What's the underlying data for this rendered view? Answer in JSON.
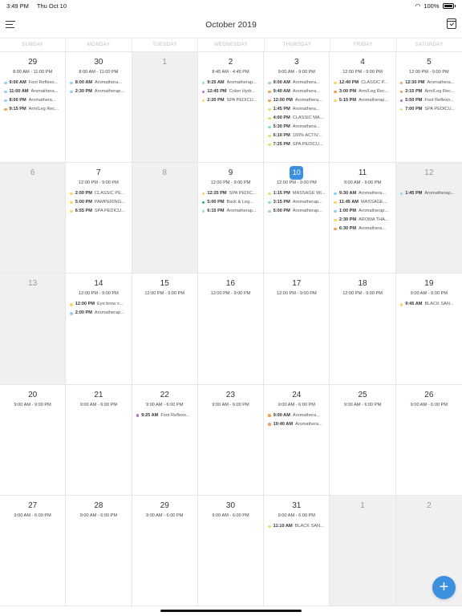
{
  "status_bar": {
    "time": "3:49 PM",
    "date": "Thu Oct 10",
    "battery": "100%"
  },
  "header": {
    "title": "October 2019"
  },
  "weekdays": [
    "SUNDAY",
    "MONDAY",
    "TUESDAY",
    "WEDNESDAY",
    "THURSDAY",
    "FRIDAY",
    "SATURDAY"
  ],
  "colors": {
    "accent": "#3d8fe0",
    "dot_blue": "#8fd3f0",
    "dot_orange": "#f5a04a",
    "dot_purple": "#b070d8",
    "dot_yellow": "#f6d868",
    "dot_green": "#2aaa8a"
  },
  "days": [
    {
      "num": "29",
      "gray": false,
      "hours": "8:00 AM - 11:00 PM",
      "events": [
        {
          "time": "9:00 AM",
          "name": "Foot Reflexo...",
          "color": "#8fd3f0"
        },
        {
          "time": "11:00 AM",
          "name": "Aromathera...",
          "color": "#8fd3f0"
        },
        {
          "time": "8:00 PM",
          "name": "Aromathera...",
          "color": "#8fd3f0"
        },
        {
          "time": "9:15 PM",
          "name": "Arm/Leg Rec...",
          "color": "#f5a04a"
        }
      ]
    },
    {
      "num": "30",
      "gray": false,
      "hours": "8:00 AM - 11:00 PM",
      "events": [
        {
          "time": "8:00 AM",
          "name": "Aromathera...",
          "color": "#8fd3f0"
        },
        {
          "time": "2:30 PM",
          "name": "Aromatherap...",
          "color": "#8fd3f0"
        }
      ]
    },
    {
      "num": "1",
      "gray": true,
      "hours": "",
      "events": []
    },
    {
      "num": "2",
      "gray": false,
      "hours": "8:45 AM - 4:45 PM",
      "events": [
        {
          "time": "9:25 AM",
          "name": "Aromatherap...",
          "color": "#8fd3f0"
        },
        {
          "time": "12:45 PM",
          "name": "Colon Hydr...",
          "color": "#b070d8"
        },
        {
          "time": "2:20 PM",
          "name": "SPA PEDICU...",
          "color": "#f6d868"
        }
      ]
    },
    {
      "num": "3",
      "gray": false,
      "hours": "9:00 AM - 9:00 PM",
      "events": [
        {
          "time": "9:00 AM",
          "name": "Aromathera...",
          "color": "#8fd3f0"
        },
        {
          "time": "9:40 AM",
          "name": "Aromathera...",
          "color": "#f5a04a"
        },
        {
          "time": "12:00 PM",
          "name": "Aromathera...",
          "color": "#f5a04a"
        },
        {
          "time": "1:45 PM",
          "name": "Aromathera...",
          "color": "#f6d868"
        },
        {
          "time": "4:00 PM",
          "name": "CLASSIC MA...",
          "color": "#f6d868"
        },
        {
          "time": "5:30 PM",
          "name": "Aromathera...",
          "color": "#8fd3f0"
        },
        {
          "time": "6:10 PM",
          "name": "100% ACTIV...",
          "color": "#f6d868"
        },
        {
          "time": "7:25 PM",
          "name": "SPA PEDICU...",
          "color": "#f6d868"
        }
      ]
    },
    {
      "num": "4",
      "gray": false,
      "hours": "12:00 PM - 9:00 PM",
      "events": [
        {
          "time": "12:40 PM",
          "name": "CLASSIC P...",
          "color": "#f6d868"
        },
        {
          "time": "3:00 PM",
          "name": "Arm/Leg Rec...",
          "color": "#f5a04a"
        },
        {
          "time": "5:15 PM",
          "name": "Aromatherap...",
          "color": "#f6d868"
        }
      ]
    },
    {
      "num": "5",
      "gray": false,
      "hours": "12:00 PM - 9:00 PM",
      "events": [
        {
          "time": "12:30 PM",
          "name": "Aromathera...",
          "color": "#f5a04a"
        },
        {
          "time": "2:15 PM",
          "name": "Arm/Leg Rec...",
          "color": "#f5a04a"
        },
        {
          "time": "5:50 PM",
          "name": "Foot Reflexo...",
          "color": "#b070d8"
        },
        {
          "time": "7:00 PM",
          "name": "SPA PEDICU...",
          "color": "#f6d868"
        }
      ]
    },
    {
      "num": "6",
      "gray": true,
      "hours": "",
      "events": []
    },
    {
      "num": "7",
      "gray": false,
      "hours": "12:00 PM - 9:00 PM",
      "events": [
        {
          "time": "2:00 PM",
          "name": "CLASSIC PE...",
          "color": "#f6d868"
        },
        {
          "time": "5:00 PM",
          "name": "PAMPERING...",
          "color": "#f6d868"
        },
        {
          "time": "6:55 PM",
          "name": "SPA PEDICU...",
          "color": "#f6d868"
        }
      ]
    },
    {
      "num": "8",
      "gray": true,
      "hours": "",
      "events": []
    },
    {
      "num": "9",
      "gray": false,
      "hours": "12:00 PM - 9:00 PM",
      "events": [
        {
          "time": "12:35 PM",
          "name": "SPA PEDIC...",
          "color": "#f6d868"
        },
        {
          "time": "5:00 PM",
          "name": "Back & Leg...",
          "color": "#2aaa8a"
        },
        {
          "time": "6:15 PM",
          "name": "Aromatherap...",
          "color": "#8fd3f0"
        }
      ]
    },
    {
      "num": "10",
      "gray": false,
      "today": true,
      "hours": "12:00 PM - 9:00 PM",
      "events": [
        {
          "time": "1:15 PM",
          "name": "MASSAGE WI...",
          "color": "#f6d868"
        },
        {
          "time": "3:15 PM",
          "name": "Aromatherap...",
          "color": "#8fd3f0"
        },
        {
          "time": "5:00 PM",
          "name": "Aromatherap...",
          "color": "#8fd3f0"
        }
      ]
    },
    {
      "num": "11",
      "gray": false,
      "hours": "9:00 AM - 9:00 PM",
      "events": [
        {
          "time": "9:30 AM",
          "name": "Aromathera...",
          "color": "#8fd3f0"
        },
        {
          "time": "11:45 AM",
          "name": "MASSAGE...",
          "color": "#f6d868"
        },
        {
          "time": "1:00 PM",
          "name": "Aromatherap...",
          "color": "#8fd3f0"
        },
        {
          "time": "2:30 PM",
          "name": "AROMA THA...",
          "color": "#f6d868"
        },
        {
          "time": "6:30 PM",
          "name": "Aromathera...",
          "color": "#f5a04a"
        }
      ]
    },
    {
      "num": "12",
      "gray": true,
      "hours": "",
      "events": [
        {
          "time": "1:45 PM",
          "name": "Aromatherap...",
          "color": "#8fd3f0"
        }
      ]
    },
    {
      "num": "13",
      "gray": true,
      "hours": "",
      "events": []
    },
    {
      "num": "14",
      "gray": false,
      "hours": "12:00 PM - 9:00 PM",
      "events": [
        {
          "time": "12:00 PM",
          "name": "Eye brow s...",
          "color": "#f6d868"
        },
        {
          "time": "2:00 PM",
          "name": "Aromatherap...",
          "color": "#8fd3f0"
        }
      ]
    },
    {
      "num": "15",
      "gray": false,
      "hours": "12:00 PM - 9:00 PM",
      "events": []
    },
    {
      "num": "16",
      "gray": false,
      "hours": "12:00 PM - 9:00 PM",
      "events": []
    },
    {
      "num": "17",
      "gray": false,
      "hours": "12:00 PM - 9:00 PM",
      "events": []
    },
    {
      "num": "18",
      "gray": false,
      "hours": "12:00 PM - 9:00 PM",
      "events": []
    },
    {
      "num": "19",
      "gray": false,
      "hours": "9:00 AM - 9:00 PM",
      "events": [
        {
          "time": "9:45 AM",
          "name": "BLACK SAN...",
          "color": "#f6d868"
        }
      ]
    },
    {
      "num": "20",
      "gray": false,
      "hours": "9:00 AM - 9:00 PM",
      "events": []
    },
    {
      "num": "21",
      "gray": false,
      "hours": "9:00 AM - 6:00 PM",
      "events": []
    },
    {
      "num": "22",
      "gray": false,
      "hours": "9:00 AM - 6:00 PM",
      "events": [
        {
          "time": "9:25 AM",
          "name": "Foot Reflexo...",
          "color": "#b070d8"
        }
      ]
    },
    {
      "num": "23",
      "gray": false,
      "hours": "9:00 AM - 6:00 PM",
      "events": []
    },
    {
      "num": "24",
      "gray": false,
      "hours": "9:00 AM - 6:00 PM",
      "events": [
        {
          "time": "9:00 AM",
          "name": "Aromathera...",
          "color": "#f5a04a"
        },
        {
          "time": "10:40 AM",
          "name": "Aromathera...",
          "color": "#f5a04a"
        }
      ]
    },
    {
      "num": "25",
      "gray": false,
      "hours": "9:00 AM - 6:00 PM",
      "events": []
    },
    {
      "num": "26",
      "gray": false,
      "hours": "9:00 AM - 6:00 PM",
      "events": []
    },
    {
      "num": "27",
      "gray": false,
      "hours": "9:00 AM - 6:00 PM",
      "events": []
    },
    {
      "num": "28",
      "gray": false,
      "hours": "9:00 AM - 6:00 PM",
      "events": []
    },
    {
      "num": "29",
      "gray": false,
      "hours": "9:00 AM - 6:00 PM",
      "events": []
    },
    {
      "num": "30",
      "gray": false,
      "hours": "9:00 AM - 6:00 PM",
      "events": []
    },
    {
      "num": "31",
      "gray": false,
      "hours": "9:00 AM - 6:00 PM",
      "events": [
        {
          "time": "11:10 AM",
          "name": "BLACK SAN...",
          "color": "#f6d868"
        }
      ]
    },
    {
      "num": "1",
      "gray": true,
      "hours": "",
      "events": []
    },
    {
      "num": "2",
      "gray": true,
      "hours": "",
      "events": []
    }
  ],
  "fab": {
    "label": "+"
  }
}
